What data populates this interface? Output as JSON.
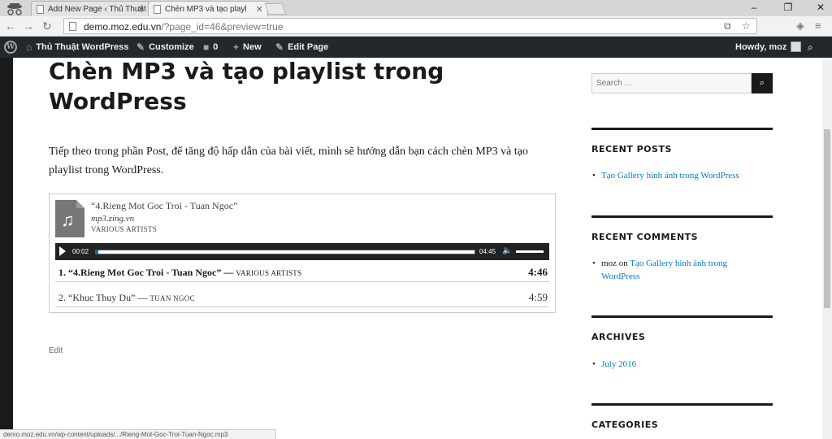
{
  "browser": {
    "tabs": [
      {
        "title": "Add New Page ‹ Thủ Thuật"
      },
      {
        "title": "Chèn MP3 và tạo playl"
      }
    ],
    "url_host": "demo.moz.edu.vn",
    "url_path": "/?page_id=46&preview=true",
    "status_text": "demo.moz.edu.vn/wp-content/uploads/.../Rieng-Mot-Goc-Troi-Tuan-Ngoc.mp3"
  },
  "adminbar": {
    "site_name": "Thủ Thuật WordPress",
    "customize": "Customize",
    "comments_count": "0",
    "new": "New",
    "edit_page": "Edit Page",
    "howdy": "Howdy, moz"
  },
  "post": {
    "title_line1": "Chèn MP3 và tạo playlist trong",
    "title_line2": "WordPress",
    "intro": "Tiếp theo trong phần Post, để tăng độ hấp dẫn của bài viết, mình sẽ hướng dẫn bạn cách chèn MP3 và tạo playlist trong WordPress.",
    "edit": "Edit"
  },
  "playlist": {
    "current_title": "“4.Rieng Mot Goc Troi - Tuan Ngoc”",
    "current_album": "mp3.zing.vn",
    "current_artist": "VARIOUS ARTISTS",
    "time_current": "00:02",
    "time_duration": "04:45",
    "progress": 0.007,
    "tracks": [
      {
        "name": "1. “4.Rieng Mot Goc Troi - Tuan Ngoc”",
        "sep": "—",
        "artist": "VARIOUS ARTISTS",
        "length": "4:46"
      },
      {
        "name": "2. “Khuc Thuy Du”",
        "sep": "—",
        "artist": "TUAN NGOC",
        "length": "4:59"
      }
    ]
  },
  "sidebar": {
    "search_placeholder": "Search …",
    "recent_posts_title": "RECENT POSTS",
    "recent_posts": [
      "Tạo Gallery hình ảnh trong WordPress"
    ],
    "recent_comments_title": "RECENT COMMENTS",
    "comment_author": "moz",
    "comment_on": "on",
    "comment_post": "Tạo Gallery hình ảnh trong WordPress",
    "archives_title": "ARCHIVES",
    "archives": [
      "July 2016"
    ],
    "categories_title": "CATEGORIES"
  }
}
